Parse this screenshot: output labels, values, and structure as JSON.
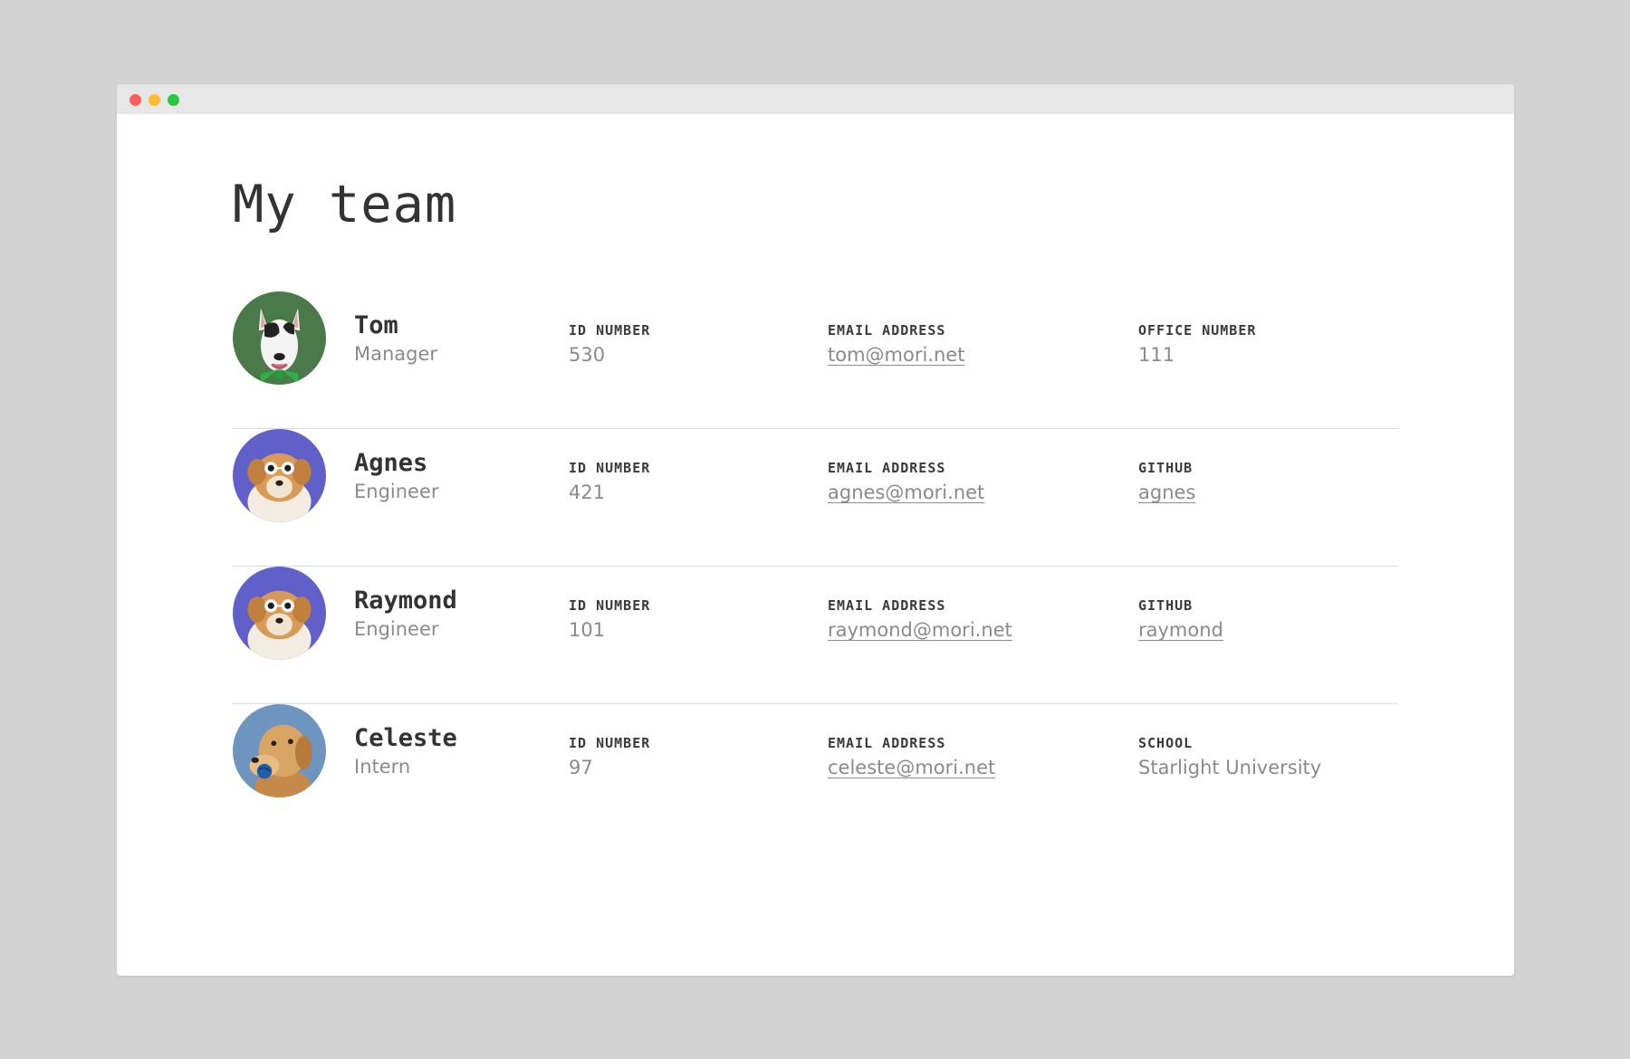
{
  "window": {
    "controls": [
      "close",
      "minimize",
      "maximize"
    ]
  },
  "page": {
    "title": "My team"
  },
  "team": [
    {
      "name": "Tom",
      "role": "Manager",
      "avatar": "bull-terrier-photo",
      "avatar_bg": "#4a7a4a",
      "id_label": "ID NUMBER",
      "id_value": "530",
      "email_label": "EMAIL ADDRESS",
      "email_value": "tom@mori.net",
      "extra_label": "OFFICE NUMBER",
      "extra_value": "111",
      "extra_is_link": false
    },
    {
      "name": "Agnes",
      "role": "Engineer",
      "avatar": "fluffy-dog-sunglasses-photo",
      "avatar_bg": "#6060c8",
      "id_label": "ID NUMBER",
      "id_value": "421",
      "email_label": "EMAIL ADDRESS",
      "email_value": "agnes@mori.net",
      "extra_label": "GITHUB",
      "extra_value": "agnes",
      "extra_is_link": true
    },
    {
      "name": "Raymond",
      "role": "Engineer",
      "avatar": "fluffy-dog-sunglasses-photo",
      "avatar_bg": "#6060c8",
      "id_label": "ID NUMBER",
      "id_value": "101",
      "email_label": "EMAIL ADDRESS",
      "email_value": "raymond@mori.net",
      "extra_label": "GITHUB",
      "extra_value": "raymond",
      "extra_is_link": true
    },
    {
      "name": "Celeste",
      "role": "Intern",
      "avatar": "golden-retriever-ball-photo",
      "avatar_bg": "#6e95c0",
      "id_label": "ID NUMBER",
      "id_value": "97",
      "email_label": "EMAIL ADDRESS",
      "email_value": "celeste@mori.net",
      "extra_label": "SCHOOL",
      "extra_value": "Starlight University",
      "extra_is_link": false
    }
  ],
  "colors": {
    "page_bg": "#d3d3d3",
    "window_bg": "#ffffff",
    "titlebar_bg": "#e7e7e7",
    "text_dark": "#333333",
    "text_muted": "#8a8a8a",
    "divider": "#dcdcdc",
    "close": "#fc5f57",
    "minimize": "#fdbc2e",
    "maximize": "#28c840"
  }
}
